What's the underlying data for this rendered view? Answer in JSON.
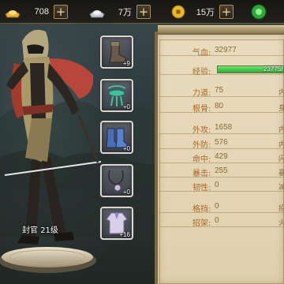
{
  "resources": [
    {
      "icon": "gold-ingot-icon",
      "value": "708"
    },
    {
      "icon": "silver-ingot-icon",
      "value": "7万"
    },
    {
      "icon": "gold-coin-icon",
      "value": "15万"
    },
    {
      "icon": "jade-orb-icon",
      "value": ""
    }
  ],
  "equipment": [
    {
      "icon": "boots-icon",
      "badge": "+9"
    },
    {
      "icon": "jade-pendant-icon",
      "badge": "+0"
    },
    {
      "icon": "blue-boots-icon",
      "badge": "+0"
    },
    {
      "icon": "necklace-icon",
      "badge": "+0"
    },
    {
      "icon": "robe-icon",
      "badge": "+16"
    }
  ],
  "character": {
    "name": "封官",
    "level": "21级"
  },
  "stats": {
    "hp": {
      "label": "气血:",
      "value": "32977"
    },
    "exp": {
      "label": "经验:",
      "value": "23775/",
      "progress": 1.0
    },
    "strength": {
      "label": "力道:",
      "value": "75",
      "edge": "内"
    },
    "constitution": {
      "label": "根骨:",
      "value": "80",
      "edge": "身"
    },
    "attack": {
      "label": "外攻:",
      "value": "1658",
      "edge": "内"
    },
    "defense": {
      "label": "外防:",
      "value": "576",
      "edge": "内"
    },
    "hit": {
      "label": "命中:",
      "value": "429",
      "edge": "闪"
    },
    "crit": {
      "label": "暴击:",
      "value": "255",
      "edge": "暴"
    },
    "toughness": {
      "label": "韧性:",
      "value": "0",
      "edge": "减"
    },
    "block": {
      "label": "格挡:",
      "value": "0",
      "edge": "招"
    },
    "parry": {
      "label": "招架:",
      "value": "0",
      "edge": "火"
    }
  },
  "colors": {
    "label": "#a8692a",
    "value": "#8a6a3c",
    "exp": "#3fc64a",
    "panel": "#e6d8b8"
  }
}
